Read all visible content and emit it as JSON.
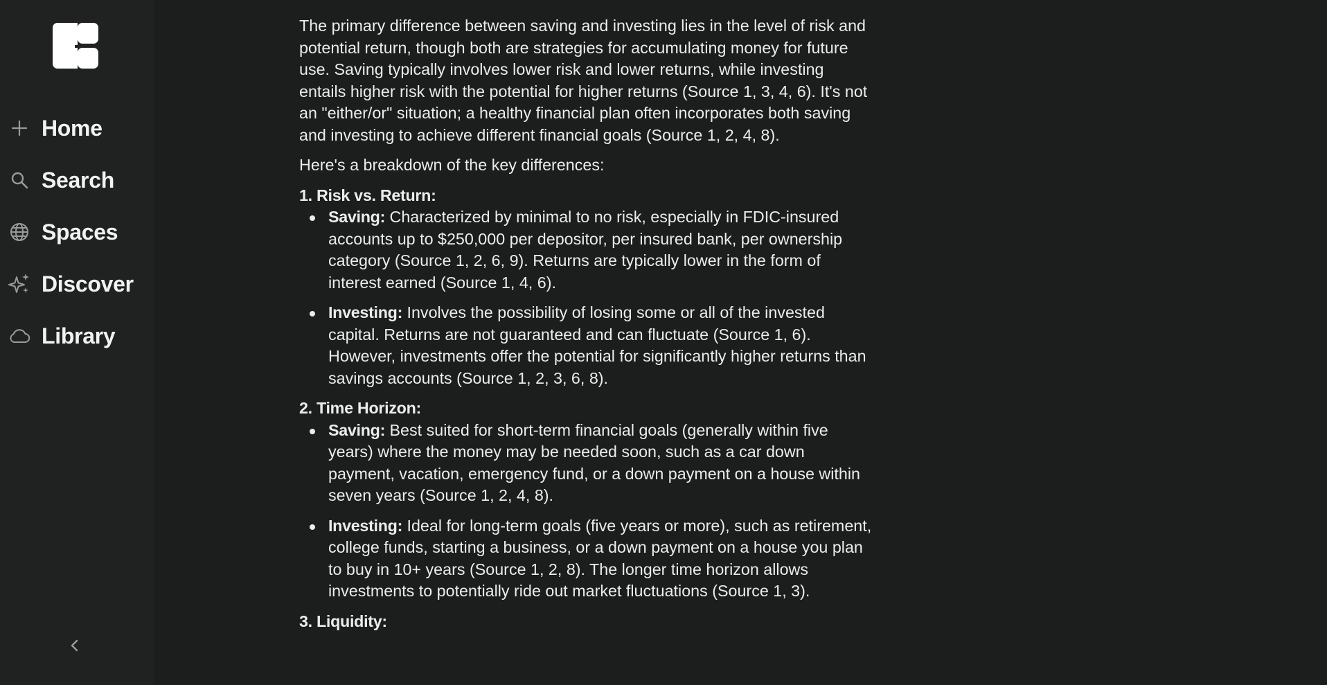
{
  "sidebar": {
    "items": [
      {
        "label": "Home",
        "icon": "plus-icon"
      },
      {
        "label": "Search",
        "icon": "search-icon"
      },
      {
        "label": "Spaces",
        "icon": "globe-icon"
      },
      {
        "label": "Discover",
        "icon": "sparkle-icon"
      },
      {
        "label": "Library",
        "icon": "cloud-icon"
      }
    ],
    "collapse_icon": "chevron-left-icon"
  },
  "article": {
    "intro": "The primary difference between saving and investing lies in the level of risk and potential return, though both are strategies for accumulating money for future use. Saving typically involves lower risk and lower returns, while investing entails higher risk with the potential for higher returns (Source 1, 3, 4, 6). It's not an \"either/or\" situation; a healthy financial plan often incorporates both saving and investing to achieve different financial goals (Source 1, 2, 4, 8).",
    "breakdown": "Here's a breakdown of the key differences:",
    "sections": [
      {
        "heading": "1. Risk vs. Return:",
        "bullets": [
          {
            "term": "Saving:",
            "text": " Characterized by minimal to no risk, especially in FDIC-insured accounts up to $250,000 per depositor, per insured bank, per ownership category (Source 1, 2, 6, 9). Returns are typically lower in the form of interest earned (Source 1, 4, 6)."
          },
          {
            "term": "Investing:",
            "text": " Involves the possibility of losing some or all of the invested capital. Returns are not guaranteed and can fluctuate (Source 1, 6). However, investments offer the potential for significantly higher returns than savings accounts (Source 1, 2, 3, 6, 8)."
          }
        ]
      },
      {
        "heading": "2. Time Horizon:",
        "bullets": [
          {
            "term": "Saving:",
            "text": " Best suited for short-term financial goals (generally within five years) where the money may be needed soon, such as a car down payment, vacation, emergency fund, or a down payment on a house within seven years (Source 1, 2, 4, 8)."
          },
          {
            "term": "Investing:",
            "text": " Ideal for long-term goals (five years or more), such as retirement, college funds, starting a business, or a down payment on a house you plan to buy in 10+ years (Source 1, 2, 8). The longer time horizon allows investments to potentially ride out market fluctuations (Source 1, 3)."
          }
        ]
      },
      {
        "heading": "3. Liquidity:",
        "bullets": []
      }
    ]
  },
  "colors": {
    "background": "#1c1d1d",
    "sidebar": "#202222",
    "text": "#ececec"
  }
}
